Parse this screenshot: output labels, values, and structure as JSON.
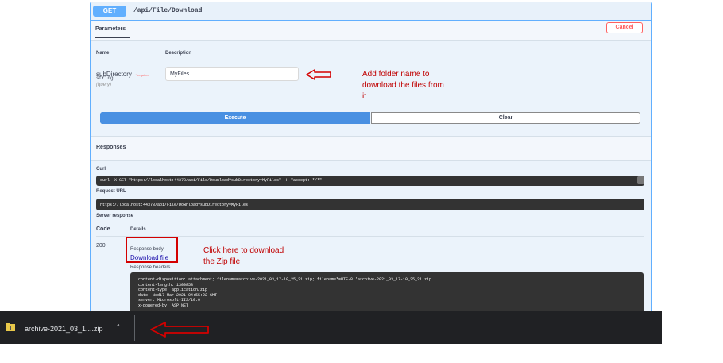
{
  "operation": {
    "method": "GET",
    "path": "/api/File/Download"
  },
  "parameters": {
    "tab_label": "Parameters",
    "cancel_label": "Cancel",
    "col_name": "Name",
    "col_description": "Description",
    "param": {
      "name": "subDirectory",
      "required_mark": "* required",
      "type": "string",
      "in": "(query)",
      "value": "MyFiles"
    }
  },
  "actions": {
    "execute_label": "Execute",
    "clear_label": "Clear"
  },
  "responses": {
    "title": "Responses",
    "curl_label": "Curl",
    "curl_command": "curl -X GET \"https://localhost:44378/api/File/Download?subDirectory=MyFiles\" -H  \"accept: */*\"",
    "request_url_label": "Request URL",
    "request_url": "https://localhost:44378/api/File/Download?subDirectory=MyFiles",
    "server_response_label": "Server response",
    "col_code": "Code",
    "col_details": "Details",
    "code": "200",
    "body_label": "Response body",
    "download_link": "Download file",
    "headers_label": "Response headers",
    "headers_text": " content-disposition: attachment; filename=archive-2021_03_17-10_25_21.zip; filename*=UTF-8''archive-2021_03_17-10_25_21.zip\n content-length: 1300858\n content-type: application/zip\n date: Wed17 Mar 2021 04:55:22 GMT\n server: Microsoft-IIS/10.0\n x-powered-by: ASP.NET"
  },
  "annotations": {
    "folder_note": [
      "Add folder name  to",
      "download the files from",
      "it"
    ],
    "download_note": [
      "Click here to download",
      "the Zip file"
    ],
    "red_color": "#d40000"
  },
  "download_bar": {
    "file_name": "archive-2021_03_1....zip",
    "chevron": "^",
    "icon": "zip-file-icon"
  }
}
